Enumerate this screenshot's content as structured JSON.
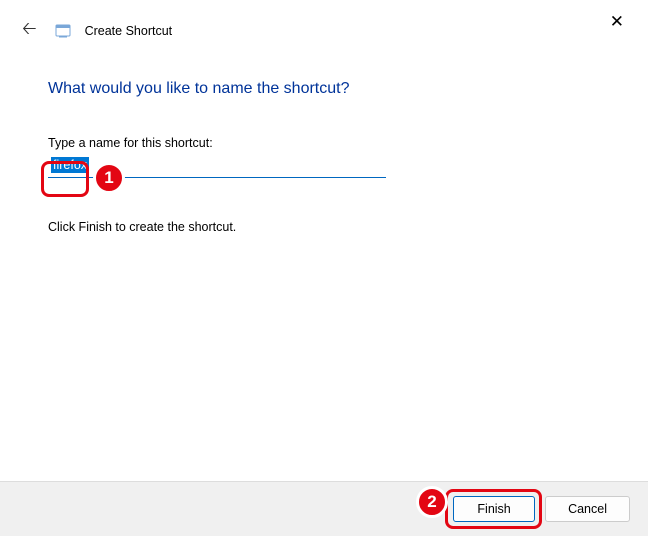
{
  "window": {
    "title": "Create Shortcut"
  },
  "content": {
    "heading": "What would you like to name the shortcut?",
    "field_label": "Type a name for this shortcut:",
    "input_value": "firefox",
    "instruction": "Click Finish to create the shortcut."
  },
  "footer": {
    "finish_label": "Finish",
    "cancel_label": "Cancel"
  },
  "annotations": {
    "step1": "1",
    "step2": "2"
  }
}
